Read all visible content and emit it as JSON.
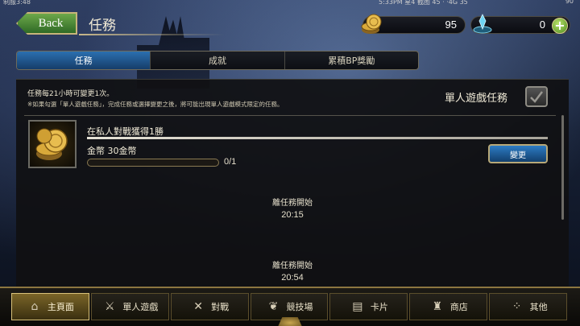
{
  "status_bar": {
    "left": "制服3:48",
    "middle": "5:33PM 星4 截图 45 · ·4G 35",
    "right": "90"
  },
  "header": {
    "back_label": "Back",
    "title": "任務",
    "gold_amount": "95",
    "crystal_amount": "0",
    "plus_label": "+"
  },
  "tabs": [
    {
      "label": "任務",
      "active": true
    },
    {
      "label": "成就",
      "active": false
    },
    {
      "label": "累積BP獎勵",
      "active": false
    }
  ],
  "panel": {
    "note_refresh": "任務每21小時可變更1次。",
    "note_solo": "※如果勾選「單人遊戲任務」，完成任務或選擇變更之後，將可能出現單人遊戲模式限定的任務。",
    "solo_label": "單人遊戲任務",
    "mission": {
      "title": "在私人對戰獲得1勝",
      "reward": "金幣 30金幣",
      "progress_text": "0/1",
      "progress_fraction": 0,
      "change_label": "變更"
    },
    "next_missions": [
      {
        "label": "離任務開始",
        "time": "20:15"
      },
      {
        "label": "離任務開始",
        "time": "20:54"
      }
    ]
  },
  "bottom_nav": [
    {
      "label": "主頁面",
      "icon": "home-icon",
      "active": true
    },
    {
      "label": "單人遊戲",
      "icon": "swords-icon",
      "active": false
    },
    {
      "label": "對戰",
      "icon": "crossed-swords-icon",
      "active": false
    },
    {
      "label": "競技場",
      "icon": "laurel-icon",
      "active": false
    },
    {
      "label": "卡片",
      "icon": "cards-icon",
      "active": false
    },
    {
      "label": "商店",
      "icon": "shop-icon",
      "active": false
    },
    {
      "label": "其他",
      "icon": "more-icon",
      "active": false
    }
  ],
  "colors": {
    "accent_blue": "#2b6fb0",
    "accent_green": "#4d8a1f",
    "gold_border": "#c8b88a"
  }
}
